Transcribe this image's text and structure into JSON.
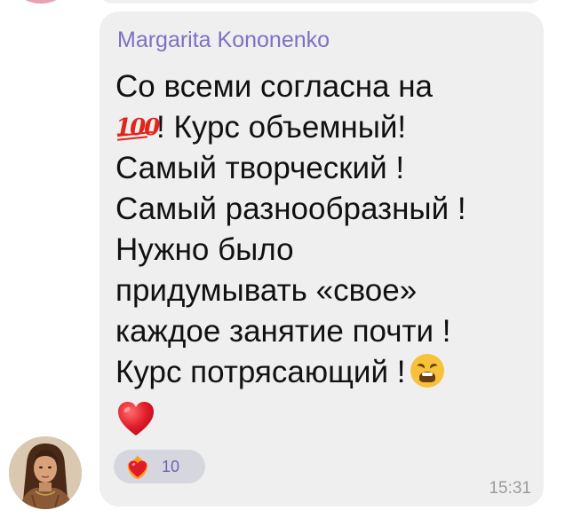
{
  "message": {
    "sender": "Margarita Kononenko",
    "lines": {
      "l1": "Со всеми согласна на",
      "l2_text": "! Курс объемный!",
      "l3": "Самый творческий !",
      "l4": "Самый разнообразный !",
      "l5": "Нужно было",
      "l6": "придумывать «свое»",
      "l7": "каждое занятие почти !",
      "l8": "Курс потрясающий !"
    },
    "emojis": [
      "hundred-points-emoji",
      "weary-face-emoji",
      "red-heart-emoji"
    ],
    "time": "15:31"
  },
  "reaction": {
    "emoji": "heart-on-fire-emoji",
    "count": "10"
  },
  "colors": {
    "bubble": "#efefef",
    "sender_name": "#7e70c4",
    "reaction_pill": "#d5d6de",
    "reaction_count": "#6a63b2",
    "timestamp": "#9b9b9b"
  }
}
